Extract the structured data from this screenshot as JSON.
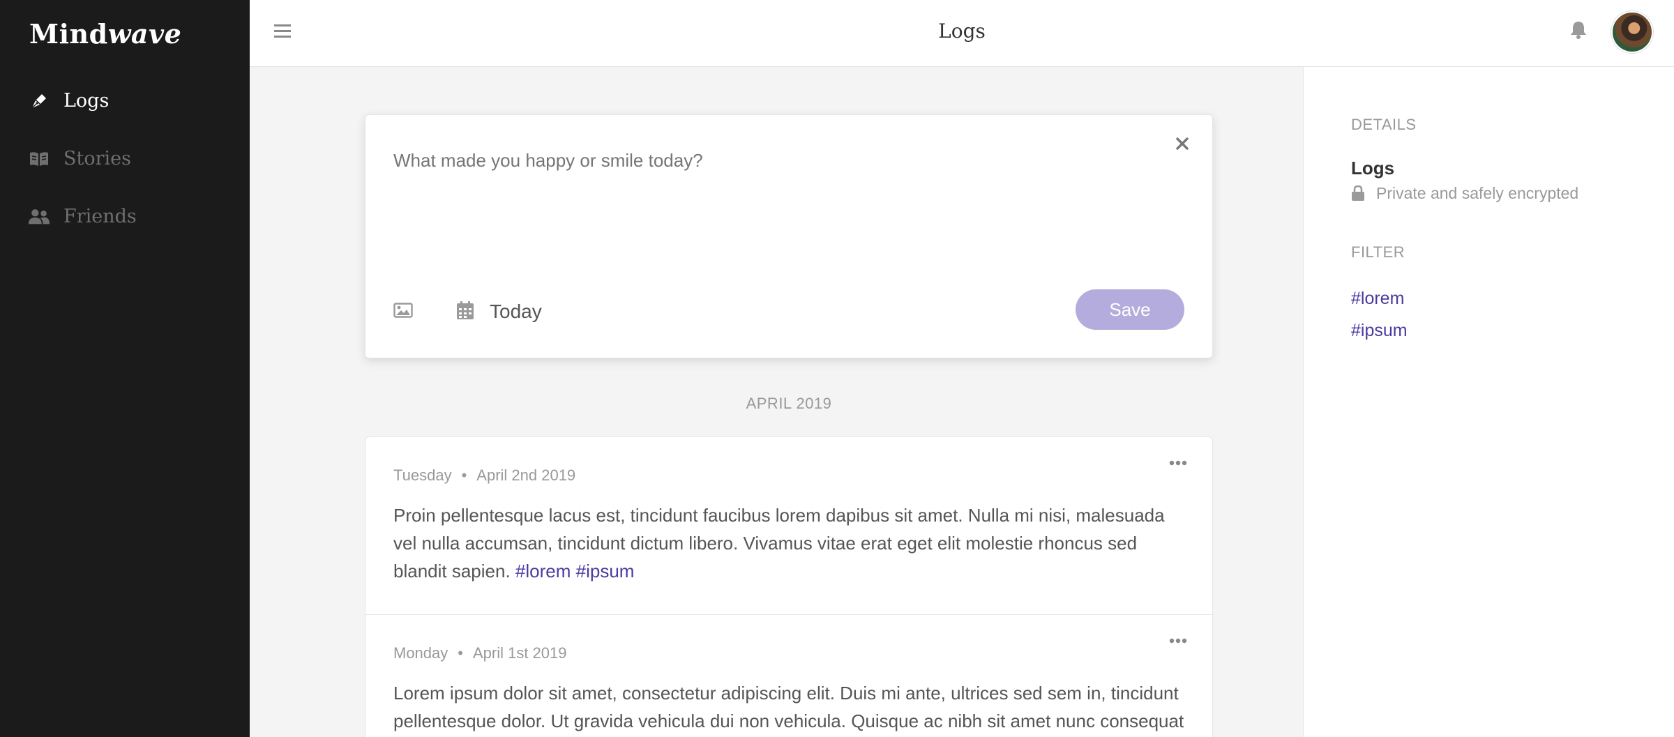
{
  "sidebar": {
    "brand_regular": "Mind",
    "brand_italic": "wave",
    "items": [
      {
        "label": "Logs",
        "icon": "pen-nib-icon",
        "active": true
      },
      {
        "label": "Stories",
        "icon": "book-icon",
        "active": false
      },
      {
        "label": "Friends",
        "icon": "users-icon",
        "active": false
      }
    ]
  },
  "header": {
    "title": "Logs"
  },
  "composer": {
    "placeholder": "What made you happy or smile today?",
    "date_label": "Today",
    "save_label": "Save"
  },
  "feed": {
    "month": "APRIL 2019",
    "entries": [
      {
        "day": "Tuesday",
        "date": "April 2nd 2019",
        "text": "Proin pellentesque lacus est, tincidunt faucibus lorem dapibus sit amet. Nulla mi nisi, malesuada vel nulla accumsan, tincidunt dictum libero. Vivamus vitae erat eget elit molestie rhoncus sed blandit sapien.",
        "tags": [
          "#lorem",
          "#ipsum"
        ]
      },
      {
        "day": "Monday",
        "date": "April 1st 2019",
        "text": "Lorem ipsum dolor sit amet, consectetur adipiscing elit. Duis mi ante, ultrices sed sem in, tincidunt pellentesque dolor. Ut gravida vehicula dui non vehicula. Quisque ac nibh sit amet nunc consequat"
      }
    ]
  },
  "details": {
    "section_label": "DETAILS",
    "title": "Logs",
    "subtitle": "Private and safely encrypted",
    "filter_label": "FILTER",
    "filters": [
      "#lorem",
      "#ipsum"
    ]
  },
  "colors": {
    "sidebar_bg": "#1b1b1b",
    "accent": "#4a3aa0",
    "save_button": "#b4acdc"
  }
}
